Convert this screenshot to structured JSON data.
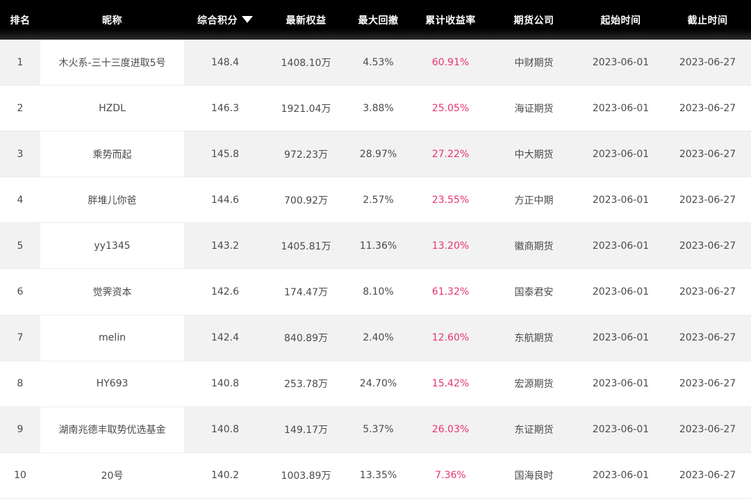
{
  "table": {
    "headers": {
      "rank": "排名",
      "name": "昵称",
      "score": "综合积分",
      "equity": "最新权益",
      "drawdown": "最大回撤",
      "return": "累计收益率",
      "company": "期货公司",
      "start": "起始时间",
      "end": "截止时间"
    },
    "sort": {
      "column": "score",
      "direction": "descending",
      "icon": "triangle-down-icon"
    },
    "colors": {
      "return_text": "#e8336f",
      "header_bg": "#000000",
      "stripe_bg": "#f2f2f2"
    },
    "rows": [
      {
        "rank": "1",
        "name": "木火系-三十三度进取5号",
        "score": "148.4",
        "equity": "1408.10万",
        "drawdown": "4.53%",
        "return": "60.91%",
        "company": "中财期货",
        "start": "2023-06-01",
        "end": "2023-06-27"
      },
      {
        "rank": "2",
        "name": "HZDL",
        "score": "146.3",
        "equity": "1921.04万",
        "drawdown": "3.88%",
        "return": "25.05%",
        "company": "海证期货",
        "start": "2023-06-01",
        "end": "2023-06-27"
      },
      {
        "rank": "3",
        "name": "乘势而起",
        "score": "145.8",
        "equity": "972.23万",
        "drawdown": "28.97%",
        "return": "27.22%",
        "company": "中大期货",
        "start": "2023-06-01",
        "end": "2023-06-27"
      },
      {
        "rank": "4",
        "name": "胖堆儿你爸",
        "score": "144.6",
        "equity": "700.92万",
        "drawdown": "2.57%",
        "return": "23.55%",
        "company": "方正中期",
        "start": "2023-06-01",
        "end": "2023-06-27"
      },
      {
        "rank": "5",
        "name": "yy1345",
        "score": "143.2",
        "equity": "1405.81万",
        "drawdown": "11.36%",
        "return": "13.20%",
        "company": "徽商期货",
        "start": "2023-06-01",
        "end": "2023-06-27"
      },
      {
        "rank": "6",
        "name": "觉霁资本",
        "score": "142.6",
        "equity": "174.47万",
        "drawdown": "8.10%",
        "return": "61.32%",
        "company": "国泰君安",
        "start": "2023-06-01",
        "end": "2023-06-27"
      },
      {
        "rank": "7",
        "name": "melin",
        "score": "142.4",
        "equity": "840.89万",
        "drawdown": "2.40%",
        "return": "12.60%",
        "company": "东航期货",
        "start": "2023-06-01",
        "end": "2023-06-27"
      },
      {
        "rank": "8",
        "name": "HY693",
        "score": "140.8",
        "equity": "253.78万",
        "drawdown": "24.70%",
        "return": "15.42%",
        "company": "宏源期货",
        "start": "2023-06-01",
        "end": "2023-06-27"
      },
      {
        "rank": "9",
        "name": "湖南兆德丰取势优选基金",
        "score": "140.8",
        "equity": "149.17万",
        "drawdown": "5.37%",
        "return": "26.03%",
        "company": "东证期货",
        "start": "2023-06-01",
        "end": "2023-06-27"
      },
      {
        "rank": "10",
        "name": "20号",
        "score": "140.2",
        "equity": "1003.89万",
        "drawdown": "13.35%",
        "return": "7.36%",
        "company": "国海良时",
        "start": "2023-06-01",
        "end": "2023-06-27"
      }
    ]
  }
}
